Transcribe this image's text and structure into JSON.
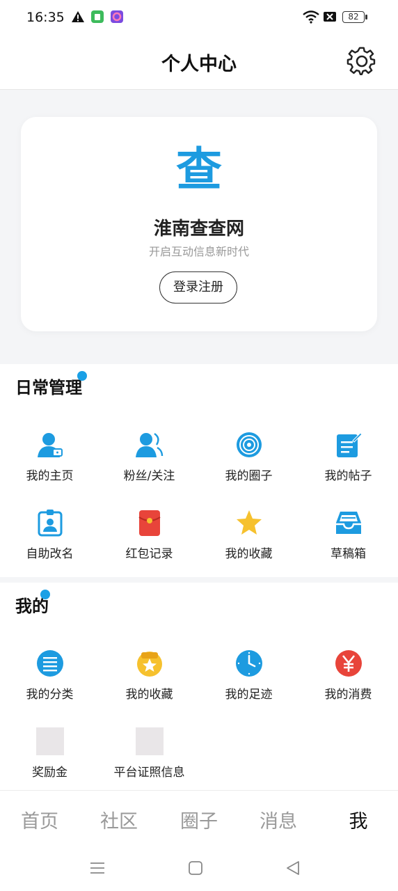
{
  "status_bar": {
    "time": "16:35",
    "battery": "82"
  },
  "header": {
    "title": "个人中心",
    "settings_icon": "gear-icon"
  },
  "profile": {
    "logo_char": "查",
    "site_name": "淮南查查网",
    "slogan": "开启互动信息新时代",
    "login_label": "登录注册"
  },
  "daily": {
    "title": "日常管理",
    "items": [
      {
        "label": "我的主页",
        "icon": "user-icon"
      },
      {
        "label": "粉丝/关注",
        "icon": "followers-icon"
      },
      {
        "label": "我的圈子",
        "icon": "circle-target-icon"
      },
      {
        "label": "我的帖子",
        "icon": "post-edit-icon"
      },
      {
        "label": "自助改名",
        "icon": "id-badge-icon"
      },
      {
        "label": "红包记录",
        "icon": "red-envelope-icon"
      },
      {
        "label": "我的收藏",
        "icon": "star-icon"
      },
      {
        "label": "草稿箱",
        "icon": "inbox-tray-icon"
      }
    ]
  },
  "mine": {
    "title": "我的",
    "items": [
      {
        "label": "我的分类",
        "icon": "list-icon"
      },
      {
        "label": "我的收藏",
        "icon": "favorite-badge-icon"
      },
      {
        "label": "我的足迹",
        "icon": "clock-icon"
      },
      {
        "label": "我的消费",
        "icon": "yen-icon"
      },
      {
        "label": "奖励金",
        "icon": "placeholder-image-icon"
      },
      {
        "label": "平台证照信息",
        "icon": "placeholder-image-icon"
      }
    ]
  },
  "tabs": [
    {
      "label": "首页"
    },
    {
      "label": "社区"
    },
    {
      "label": "圈子"
    },
    {
      "label": "消息"
    },
    {
      "label": "我"
    }
  ],
  "colors": {
    "accent": "#1d9be0",
    "red": "#e8443a",
    "yellow": "#f6c12e",
    "tab_inactive": "#999999",
    "tab_active": "#111111"
  }
}
